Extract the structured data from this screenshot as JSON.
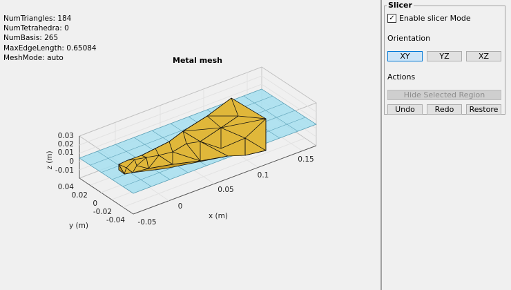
{
  "stats": {
    "num_triangles": "NumTriangles: 184",
    "num_tetrahedra": "NumTetrahedra: 0",
    "num_basis": "NumBasis: 265",
    "max_edge_length": "MaxEdgeLength: 0.65084",
    "mesh_mode": "MeshMode: auto"
  },
  "plot": {
    "title": "Metal mesh",
    "xlabel": "x (m)",
    "ylabel": "y (m)",
    "zlabel": "z (m)",
    "x_ticks": [
      "-0.05",
      "0",
      "0.05",
      "0.1",
      "0.15"
    ],
    "y_ticks": [
      "-0.04",
      "-0.02",
      "0",
      "0.02",
      "0.04"
    ],
    "z_ticks": [
      "-0.01",
      "0",
      "0.01",
      "0.02",
      "0.03"
    ]
  },
  "slicer": {
    "title": "Slicer",
    "enable_label": "Enable slicer Mode",
    "enable_checked": true,
    "orientation_label": "Orientation",
    "orientation_options": [
      "XY",
      "YZ",
      "XZ"
    ],
    "orientation_selected": "XY",
    "actions_label": "Actions",
    "hide_selected_label": "Hide Selected Region",
    "undo_label": "Undo",
    "redo_label": "Redo",
    "restore_label": "Restore"
  },
  "colors": {
    "mesh_fill": "#e0b73a",
    "slice_plane": "#a6dff0",
    "edge": "#111111"
  }
}
